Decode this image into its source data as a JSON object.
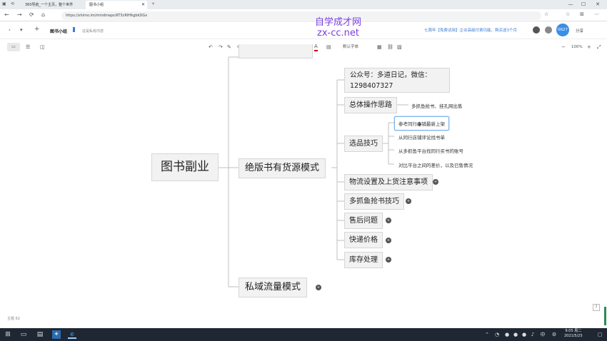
{
  "browser": {
    "tabs": [
      {
        "label": "360导航_一个主页，整个世界"
      },
      {
        "label": "图书小组"
      }
    ],
    "new_tab_label": "+",
    "url": "https://shimo.im/mindmaps/KT3cRHfkgbkDGx",
    "nav": {
      "back": "←",
      "forward": "→",
      "reload": "⟳",
      "home": "⌂"
    },
    "window_controls": {
      "min": "—",
      "max": "☐",
      "close": "✕"
    }
  },
  "header": {
    "doc_title": "图书小组",
    "save_status": "这是私有内容",
    "notice": "七周年【免费试用】企业高级付费功能，购买送3个月",
    "badge": "0627",
    "share_label": "分享"
  },
  "watermark": {
    "line1": "自学成才网",
    "line2": "zx-cc.net"
  },
  "toolbar": {
    "view_buttons": [
      "▭",
      "☰",
      "◫"
    ],
    "undo": "↶",
    "redo": "↷",
    "bold": "B",
    "italic": "I",
    "underline": "U",
    "strike": "S",
    "font_color": "A",
    "font_family": "默认字体",
    "zoom": "100%",
    "zoom_out": "−",
    "zoom_in": "+",
    "fullscreen": "⤢"
  },
  "mindmap": {
    "root": "图书副业",
    "branch_main": "绝版书有货源模式",
    "branch_private": "私域流量模式",
    "contact": {
      "line1": "公众号：多道日记，微信：",
      "line2": "1298407327"
    },
    "children": {
      "overall": "总体操作思路",
      "overall_leaf": "多抓鱼抢书、挂孔网出售",
      "selection": "选品技巧",
      "selection_leaves": [
        "参考同行店铺最新上架",
        "从同行店铺评论找书单",
        "从多抓鱼平台找同行买书的账号",
        "对比平台之间的差价，以及已售情况"
      ],
      "logistics": "物流设置及上货注意事项",
      "duozhuayu": "多抓鱼抢书技巧",
      "aftersale": "售后问题",
      "shipping": "快递价格",
      "inventory": "库存处理"
    },
    "collapse_dot": "+"
  },
  "status": {
    "label": "主题",
    "count": "62"
  },
  "taskbar": {
    "clock_time": "9:05 周二",
    "clock_date": "2021/5/25",
    "ime": "中"
  }
}
